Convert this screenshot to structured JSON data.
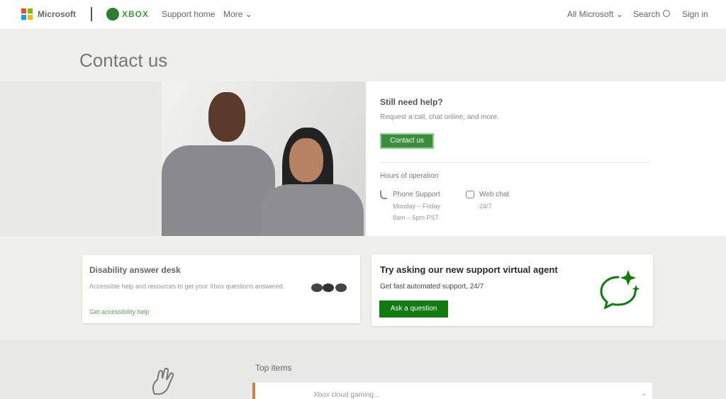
{
  "header": {
    "brand": "Microsoft",
    "product": "XBOX",
    "nav_support": "Support home",
    "nav_more": "More",
    "all_microsoft": "All Microsoft",
    "search": "Search",
    "sign_in": "Sign in"
  },
  "page": {
    "title": "Contact us"
  },
  "help": {
    "title": "Still need help?",
    "subtitle": "Request a call, chat online, and more.",
    "button_label": "Contact us",
    "hours_title": "Hours of operation",
    "phone_label": "Phone Support",
    "phone_days": "Monday – Friday",
    "phone_hours": "8am – 5pm PST",
    "chat_label": "Web chat",
    "chat_hours": "24/7"
  },
  "disability": {
    "title": "Disability answer desk",
    "description": "Accessible help and resources to get your Xbox questions answered.",
    "link": "Get accessibility help"
  },
  "virtual_agent": {
    "title": "Try asking our new support virtual agent",
    "subtitle": "Get fast automated support, 24/7",
    "button_label": "Ask a question"
  },
  "top_items": {
    "heading": "Top items",
    "first_item": "Xbox cloud gaming..."
  },
  "colors": {
    "brand_green": "#107c10",
    "ms_red": "#f25022",
    "ms_green": "#7fba00",
    "ms_blue": "#00a4ef",
    "ms_yellow": "#ffb900",
    "accent_orange": "#c8824a"
  }
}
